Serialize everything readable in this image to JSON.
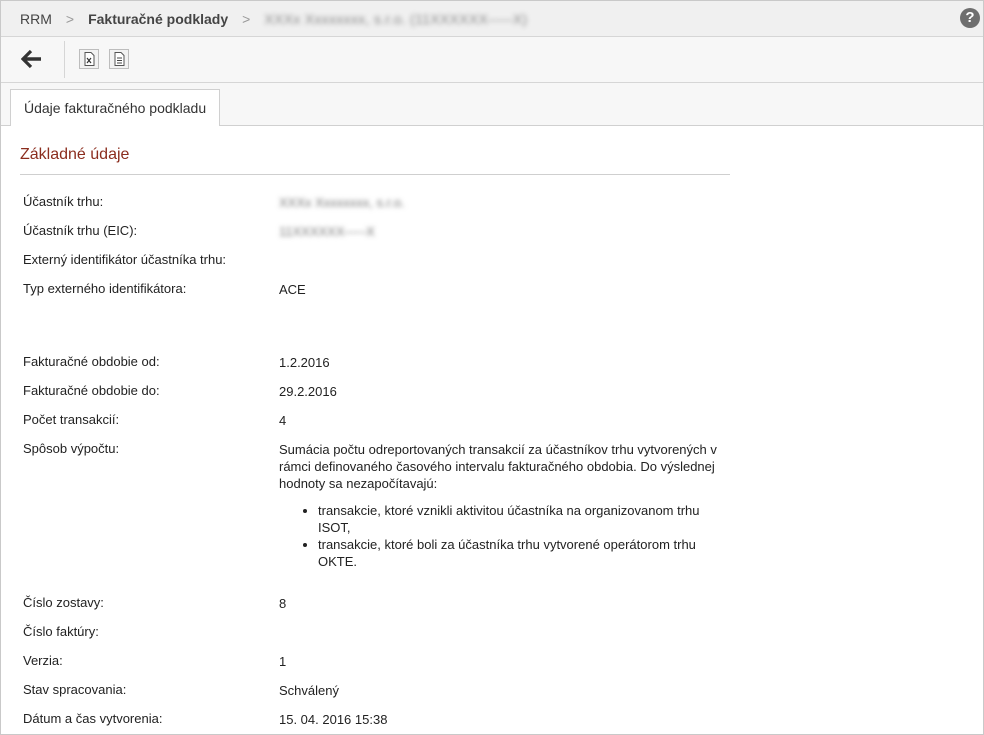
{
  "breadcrumb": {
    "root": "RRM",
    "section": "Fakturačné podklady",
    "record": "XXXx Xxxxxxxx, s.r.o. (11XXXXXX-----X)"
  },
  "toolbar": {
    "back_icon": "arrow-left-icon",
    "excel_icon": "excel-export-icon",
    "document_icon": "document-icon"
  },
  "tabs": [
    {
      "label": "Údaje fakturačného podkladu"
    }
  ],
  "section": {
    "title": "Základné údaje"
  },
  "fields": {
    "participant": {
      "label": "Účastník trhu:",
      "value": "XXXx Xxxxxxxx, s.r.o."
    },
    "participant_eic": {
      "label": "Účastník trhu (EIC):",
      "value": "11XXXXXX-----X"
    },
    "external_id": {
      "label": "Externý identifikátor účastníka trhu:",
      "value": ""
    },
    "external_id_type": {
      "label": "Typ externého identifikátora:",
      "value": "ACE"
    },
    "period_from": {
      "label": "Fakturačné obdobie od:",
      "value": "1.2.2016"
    },
    "period_to": {
      "label": "Fakturačné obdobie do:",
      "value": "29.2.2016"
    },
    "transaction_count": {
      "label": "Počet transakcií:",
      "value": "4"
    },
    "calc_method": {
      "label": "Spôsob výpočtu:",
      "value": "Sumácia počtu odreportovaných transakcií za účastníkov trhu vytvorených v rámci definovaného časového intervalu fakturačného obdobia. Do výslednej hodnoty sa nezapočítavajú:",
      "bullets": [
        "transakcie, ktoré vznikli aktivitou účastníka na organizovanom trhu ISOT,",
        "transakcie, ktoré boli za účastníka trhu vytvorené operátorom trhu OKTE."
      ]
    },
    "report_number": {
      "label": "Číslo zostavy:",
      "value": "8"
    },
    "invoice_number": {
      "label": "Číslo faktúry:",
      "value": ""
    },
    "version": {
      "label": "Verzia:",
      "value": "1"
    },
    "status": {
      "label": "Stav spracovania:",
      "value": "Schválený"
    },
    "created_at": {
      "label": "Dátum a čas vytvorenia:",
      "value": "15. 04. 2016 15:38"
    }
  },
  "help": {
    "icon": "help-icon",
    "label": "?"
  }
}
